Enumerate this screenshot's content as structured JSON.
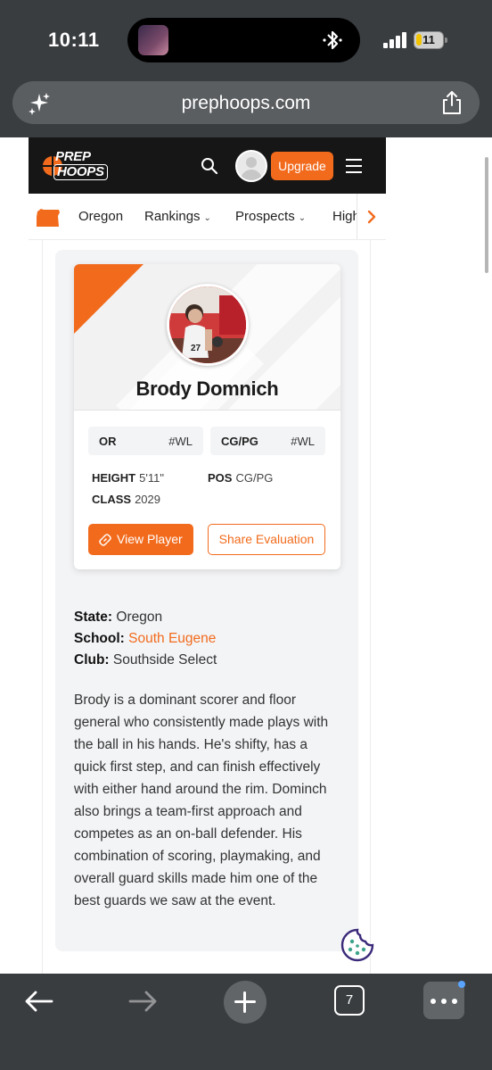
{
  "status_bar": {
    "time": "10:11",
    "battery": "11"
  },
  "browser": {
    "url": "prephoops.com",
    "open_tabs": "7"
  },
  "site": {
    "logo_line1": "PREP",
    "logo_line2": "HOOPS",
    "upgrade_label": "Upgrade"
  },
  "nav": {
    "items": [
      {
        "label": "Oregon",
        "has_menu": false
      },
      {
        "label": "Rankings",
        "has_menu": true
      },
      {
        "label": "Prospects",
        "has_menu": true
      },
      {
        "label": "High",
        "has_menu": false
      }
    ]
  },
  "player": {
    "name": "Brody Domnich",
    "jersey": "27",
    "state_rank_label": "OR",
    "state_rank_value": "#WL",
    "pos_rank_label": "CG/PG",
    "pos_rank_value": "#WL",
    "height_label": "HEIGHT",
    "height_value": "5'11\"",
    "pos_label": "POS",
    "pos_value": "CG/PG",
    "class_label": "CLASS",
    "class_value": "2029",
    "view_button": "View Player",
    "share_button": "Share Evaluation"
  },
  "details": {
    "state_label": "State:",
    "state_value": "Oregon",
    "school_label": "School:",
    "school_value": "South Eugene",
    "club_label": "Club:",
    "club_value": "Southside Select"
  },
  "evaluation": "Brody is a dominant scorer and floor general who consistently made plays with the ball in his hands. He's shifty, has a quick first step, and can finish effectively with either hand around the rim. Dominch also brings a team-first approach and competes as an on-ball defender. His combination of scoring, playmaking, and overall guard skills made him one of the best guards we saw at the event.",
  "colors": {
    "brand_orange": "#f26b1d",
    "header_black": "#161616",
    "chrome_gray": "#3a3d40"
  }
}
